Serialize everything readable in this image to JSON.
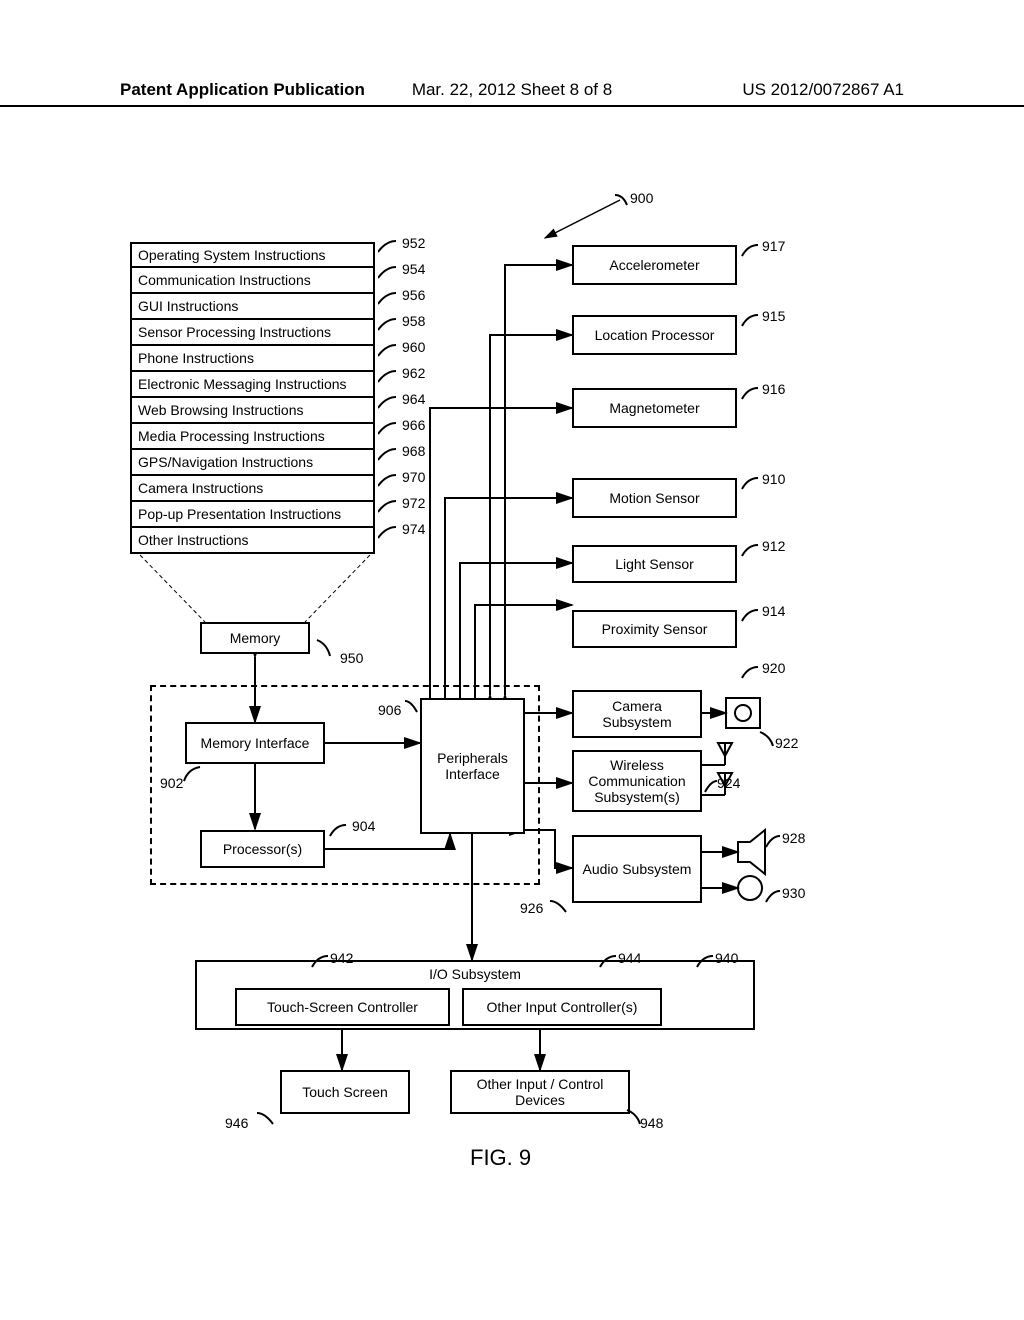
{
  "header": {
    "left": "Patent Application Publication",
    "mid": "Mar. 22, 2012  Sheet 8 of 8",
    "right": "US 2012/0072867 A1"
  },
  "figure_label": "FIG. 9",
  "instructions": [
    "Operating System Instructions",
    "Communication Instructions",
    "GUI Instructions",
    "Sensor Processing Instructions",
    "Phone Instructions",
    "Electronic Messaging Instructions",
    "Web Browsing Instructions",
    "Media Processing Instructions",
    "GPS/Navigation Instructions",
    "Camera Instructions",
    "Pop-up Presentation Instructions",
    "Other Instructions"
  ],
  "instruction_refs": [
    "952",
    "954",
    "956",
    "958",
    "960",
    "962",
    "964",
    "966",
    "968",
    "970",
    "972",
    "974"
  ],
  "memory_label": "Memory",
  "memory_ref": "950",
  "sensors": [
    {
      "label": "Accelerometer",
      "ref": "917"
    },
    {
      "label": "Location Processor",
      "ref": "915"
    },
    {
      "label": "Magnetometer",
      "ref": "916"
    },
    {
      "label": "Motion Sensor",
      "ref": "910"
    },
    {
      "label": "Light Sensor",
      "ref": "912"
    },
    {
      "label": "Proximity Sensor",
      "ref": "914"
    }
  ],
  "camera_label": "Camera Subsystem",
  "camera_ref": "920",
  "camera_icon_ref": "922",
  "wireless_label": "Wireless Communication Subsystem(s)",
  "wireless_ref": "924",
  "speaker_ref": "928",
  "audio_label": "Audio Subsystem",
  "audio_ref": "926",
  "mic_ref": "930",
  "mem_if_label": "Memory Interface",
  "mem_if_ref": "902",
  "periph_label": "Peripherals Interface",
  "periph_ref": "906",
  "proc_label": "Processor(s)",
  "proc_ref": "904",
  "io_label": "I/O Subsystem",
  "io_ref": "940",
  "touch_ctrl_label": "Touch-Screen Controller",
  "touch_ctrl_ref": "942",
  "other_ctrl_label": "Other Input Controller(s)",
  "other_ctrl_ref": "944",
  "touch_label": "Touch Screen",
  "touch_ref": "946",
  "other_dev_label": "Other Input / Control Devices",
  "other_dev_ref": "948",
  "system_ref": "900"
}
